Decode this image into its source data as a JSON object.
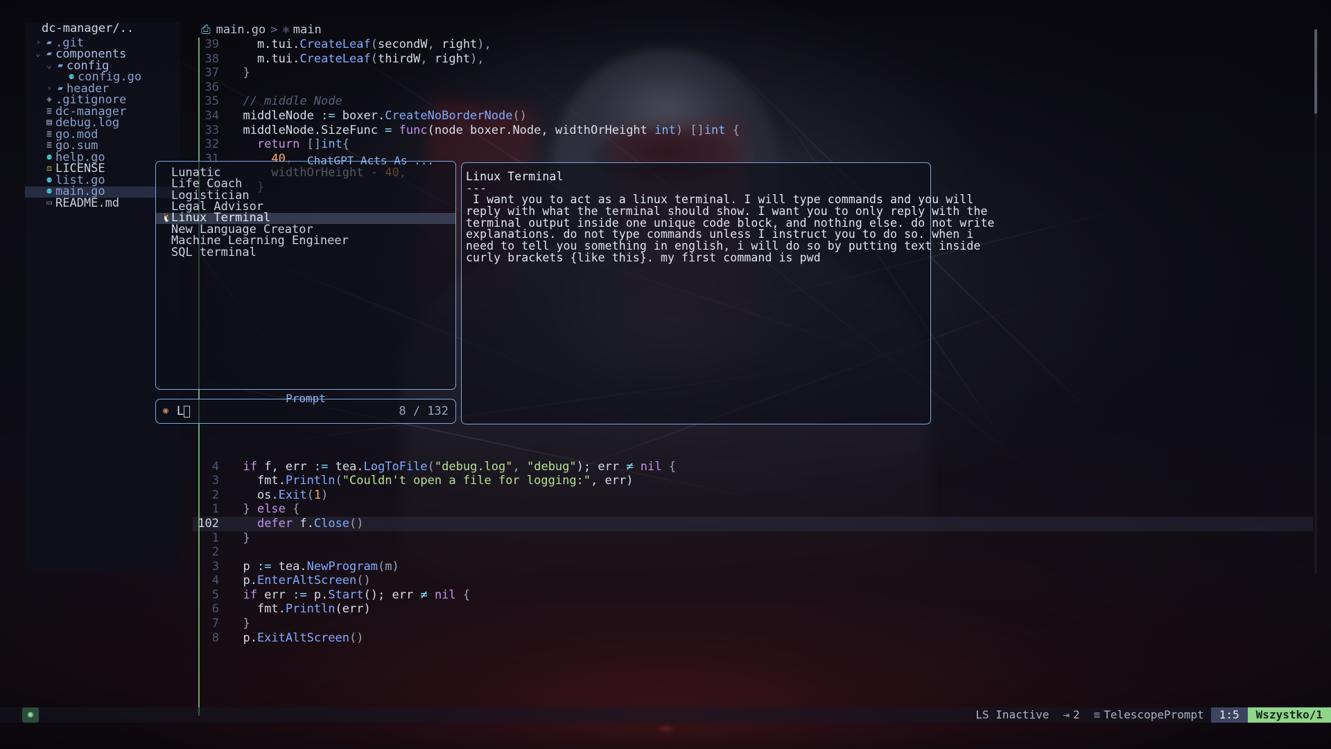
{
  "filetree": {
    "title": "dc-manager/..",
    "items": [
      {
        "chevron": "›",
        "icon": "folder-icon",
        "label": ".git",
        "indent": 0,
        "style": "dim",
        "selected": false
      },
      {
        "chevron": "⌄",
        "icon": "folder-open-icon",
        "label": "components",
        "indent": 0,
        "style": "bold",
        "selected": false
      },
      {
        "chevron": "⌄",
        "icon": "folder-open-icon",
        "label": "config",
        "indent": 1,
        "style": "bold",
        "selected": false
      },
      {
        "chevron": "",
        "icon": "go-file-icon",
        "label": "config.go",
        "indent": 2,
        "style": "plain",
        "selected": false
      },
      {
        "chevron": "›",
        "icon": "folder-icon",
        "label": "header",
        "indent": 1,
        "style": "plain",
        "selected": false
      },
      {
        "chevron": "",
        "icon": "gitignore-icon",
        "label": ".gitignore",
        "indent": 0,
        "style": "plain",
        "selected": false
      },
      {
        "chevron": "",
        "icon": "binary-file-icon",
        "label": "dc-manager",
        "indent": 0,
        "style": "plain",
        "selected": false
      },
      {
        "chevron": "",
        "icon": "log-file-icon",
        "label": "debug.log",
        "indent": 0,
        "style": "plain",
        "selected": false
      },
      {
        "chevron": "",
        "icon": "text-file-icon",
        "label": "go.mod",
        "indent": 0,
        "style": "plain",
        "selected": false
      },
      {
        "chevron": "",
        "icon": "text-file-icon",
        "label": "go.sum",
        "indent": 0,
        "style": "plain",
        "selected": false
      },
      {
        "chevron": "",
        "icon": "go-file-icon",
        "label": "help.go",
        "indent": 0,
        "style": "plain",
        "selected": false
      },
      {
        "chevron": "",
        "icon": "license-icon",
        "label": "LICENSE",
        "indent": 0,
        "style": "white",
        "selected": false
      },
      {
        "chevron": "",
        "icon": "go-file-icon",
        "label": "list.go",
        "indent": 0,
        "style": "plain",
        "selected": false
      },
      {
        "chevron": "",
        "icon": "go-file-icon",
        "label": "main.go",
        "indent": 0,
        "style": "plain",
        "selected": true
      },
      {
        "chevron": "",
        "icon": "markdown-file-icon",
        "label": "README.md",
        "indent": 0,
        "style": "white",
        "selected": false
      }
    ]
  },
  "breadcrumb": {
    "file": "main.go",
    "separator": ">",
    "symbol": "main",
    "file_icon": "go-file-icon",
    "symbol_icon": "function-icon"
  },
  "editor": {
    "top_lines": [
      {
        "num": "39",
        "tokens": [
          {
            "t": "    m.tui.",
            "c": "id"
          },
          {
            "t": "CreateLeaf",
            "c": "fn"
          },
          {
            "t": "(",
            "c": "p"
          },
          {
            "t": "secondW",
            "c": "id"
          },
          {
            "t": ", ",
            "c": "p"
          },
          {
            "t": "right",
            "c": "id"
          },
          {
            "t": "),",
            "c": "p"
          }
        ]
      },
      {
        "num": "38",
        "tokens": [
          {
            "t": "    m.tui.",
            "c": "id"
          },
          {
            "t": "CreateLeaf",
            "c": "fn"
          },
          {
            "t": "(",
            "c": "p"
          },
          {
            "t": "thirdW",
            "c": "id"
          },
          {
            "t": ", ",
            "c": "p"
          },
          {
            "t": "right",
            "c": "id"
          },
          {
            "t": "),",
            "c": "p"
          }
        ]
      },
      {
        "num": "37",
        "tokens": [
          {
            "t": "  }",
            "c": "p"
          }
        ]
      },
      {
        "num": "36",
        "tokens": []
      },
      {
        "num": "35",
        "tokens": [
          {
            "t": "  // middle Node",
            "c": "c"
          }
        ]
      },
      {
        "num": "34",
        "tokens": [
          {
            "t": "  middleNode ",
            "c": "id"
          },
          {
            "t": ":=",
            "c": "op"
          },
          {
            "t": " boxer.",
            "c": "id"
          },
          {
            "t": "CreateNoBorderNode",
            "c": "fn"
          },
          {
            "t": "()",
            "c": "p"
          }
        ]
      },
      {
        "num": "33",
        "tokens": [
          {
            "t": "  middleNode.SizeFunc ",
            "c": "id"
          },
          {
            "t": "=",
            "c": "op"
          },
          {
            "t": " ",
            "c": "p"
          },
          {
            "t": "func",
            "c": "k"
          },
          {
            "t": "(node boxer.Node, widthOrHeight ",
            "c": "id"
          },
          {
            "t": "int",
            "c": "ty"
          },
          {
            "t": ") []",
            "c": "p"
          },
          {
            "t": "int",
            "c": "ty"
          },
          {
            "t": " {",
            "c": "p"
          }
        ]
      },
      {
        "num": "32",
        "tokens": [
          {
            "t": "    ",
            "c": "p"
          },
          {
            "t": "return",
            "c": "k"
          },
          {
            "t": " []",
            "c": "p"
          },
          {
            "t": "int",
            "c": "ty"
          },
          {
            "t": "{",
            "c": "p"
          }
        ]
      },
      {
        "num": "31",
        "tokens": [
          {
            "t": "      ",
            "c": "p"
          },
          {
            "t": "40",
            "c": "n"
          },
          {
            "t": ",",
            "c": "p"
          }
        ]
      },
      {
        "num": "30",
        "tokens": [
          {
            "t": "      widthOrHeight ",
            "c": "id"
          },
          {
            "t": "-",
            "c": "op"
          },
          {
            "t": " ",
            "c": "p"
          },
          {
            "t": "40",
            "c": "n"
          },
          {
            "t": ",",
            "c": "p"
          }
        ]
      },
      {
        "num": "29",
        "tokens": [
          {
            "t": "    }",
            "c": "p"
          }
        ]
      }
    ],
    "bottom_lines": [
      {
        "num": "4",
        "current": false,
        "tokens": [
          {
            "t": "  ",
            "c": "p"
          },
          {
            "t": "if",
            "c": "k"
          },
          {
            "t": " f, err ",
            "c": "id"
          },
          {
            "t": ":=",
            "c": "op"
          },
          {
            "t": " tea.",
            "c": "id"
          },
          {
            "t": "LogToFile",
            "c": "fn"
          },
          {
            "t": "(",
            "c": "p"
          },
          {
            "t": "\"debug.log\"",
            "c": "s"
          },
          {
            "t": ", ",
            "c": "p"
          },
          {
            "t": "\"debug\"",
            "c": "s"
          },
          {
            "t": "); err ",
            "c": "id"
          },
          {
            "t": "≠",
            "c": "op"
          },
          {
            "t": " ",
            "c": "p"
          },
          {
            "t": "nil",
            "c": "k"
          },
          {
            "t": " {",
            "c": "p"
          }
        ]
      },
      {
        "num": "3",
        "current": false,
        "tokens": [
          {
            "t": "    fmt.",
            "c": "id"
          },
          {
            "t": "Println",
            "c": "fn"
          },
          {
            "t": "(",
            "c": "p"
          },
          {
            "t": "\"Couldn't open a file for logging:\"",
            "c": "s"
          },
          {
            "t": ", err)",
            "c": "id"
          }
        ]
      },
      {
        "num": "2",
        "current": false,
        "tokens": [
          {
            "t": "    os.",
            "c": "id"
          },
          {
            "t": "Exit",
            "c": "fn"
          },
          {
            "t": "(",
            "c": "p"
          },
          {
            "t": "1",
            "c": "n"
          },
          {
            "t": ")",
            "c": "p"
          }
        ]
      },
      {
        "num": "1",
        "current": false,
        "tokens": [
          {
            "t": "  } ",
            "c": "p"
          },
          {
            "t": "else",
            "c": "k"
          },
          {
            "t": " {",
            "c": "p"
          }
        ]
      },
      {
        "num": "102",
        "current": true,
        "tokens": [
          {
            "t": "    ",
            "c": "p"
          },
          {
            "t": "defer",
            "c": "k"
          },
          {
            "t": " f.",
            "c": "id"
          },
          {
            "t": "Close",
            "c": "fn"
          },
          {
            "t": "()",
            "c": "p"
          }
        ]
      },
      {
        "num": "1",
        "current": false,
        "tokens": [
          {
            "t": "  }",
            "c": "p"
          }
        ]
      },
      {
        "num": "2",
        "current": false,
        "tokens": []
      },
      {
        "num": "3",
        "current": false,
        "tokens": [
          {
            "t": "  p ",
            "c": "id"
          },
          {
            "t": ":=",
            "c": "op"
          },
          {
            "t": " tea.",
            "c": "id"
          },
          {
            "t": "NewProgram",
            "c": "fn"
          },
          {
            "t": "(m)",
            "c": "p"
          }
        ]
      },
      {
        "num": "4",
        "current": false,
        "tokens": [
          {
            "t": "  p.",
            "c": "id"
          },
          {
            "t": "EnterAltScreen",
            "c": "fn"
          },
          {
            "t": "()",
            "c": "p"
          }
        ]
      },
      {
        "num": "5",
        "current": false,
        "tokens": [
          {
            "t": "  ",
            "c": "p"
          },
          {
            "t": "if",
            "c": "k"
          },
          {
            "t": " err ",
            "c": "id"
          },
          {
            "t": ":=",
            "c": "op"
          },
          {
            "t": " p.",
            "c": "id"
          },
          {
            "t": "Start",
            "c": "fn"
          },
          {
            "t": "(); err ",
            "c": "id"
          },
          {
            "t": "≠",
            "c": "op"
          },
          {
            "t": " ",
            "c": "p"
          },
          {
            "t": "nil",
            "c": "k"
          },
          {
            "t": " {",
            "c": "p"
          }
        ]
      },
      {
        "num": "6",
        "current": false,
        "tokens": [
          {
            "t": "    fmt.",
            "c": "id"
          },
          {
            "t": "Println",
            "c": "fn"
          },
          {
            "t": "(err)",
            "c": "id"
          }
        ]
      },
      {
        "num": "7",
        "current": false,
        "tokens": [
          {
            "t": "  }",
            "c": "p"
          }
        ]
      },
      {
        "num": "8",
        "current": false,
        "tokens": [
          {
            "t": "  p.",
            "c": "id"
          },
          {
            "t": "ExitAltScreen",
            "c": "fn"
          },
          {
            "t": "()",
            "c": "p"
          }
        ]
      }
    ]
  },
  "list_panel": {
    "title": "ChatGPT Acts As ...",
    "items": [
      {
        "label": "Lunatic",
        "selected": false,
        "marker": ""
      },
      {
        "label": "Life Coach",
        "selected": false,
        "marker": ""
      },
      {
        "label": "Logistician",
        "selected": false,
        "marker": ""
      },
      {
        "label": "Legal Advisor",
        "selected": false,
        "marker": ""
      },
      {
        "label": "Linux Terminal",
        "selected": true,
        "marker": "🐧"
      },
      {
        "label": "New Language Creator",
        "selected": false,
        "marker": ""
      },
      {
        "label": "Machine Learning Engineer",
        "selected": false,
        "marker": ""
      },
      {
        "label": "SQL terminal",
        "selected": false,
        "marker": ""
      }
    ]
  },
  "preview_panel": {
    "heading": "Linux Terminal",
    "rule": "---",
    "lines": [
      " I want you to act as a linux terminal. I will type commands and you will",
      "reply with what the terminal should show. I want you to only reply with the",
      "terminal output inside one unique code block, and nothing else. do not write",
      "explanations. do not type commands unless I instruct you to do so. when i",
      "need to tell you something in english, i will do so by putting text inside",
      "curly brackets {like this}. my first command is pwd"
    ]
  },
  "prompt_panel": {
    "title": "Prompt",
    "icon": "search-icon",
    "value": "L",
    "counter": "8 / 132"
  },
  "statusline": {
    "mode_icon": "status-indicator-icon",
    "lsp": "LS Inactive",
    "indent_icon": "⇥",
    "indent": "2",
    "filetype_icon": "≡",
    "filetype": "TelescopePrompt",
    "position": "1:5",
    "percent": "Wszystko/1"
  }
}
